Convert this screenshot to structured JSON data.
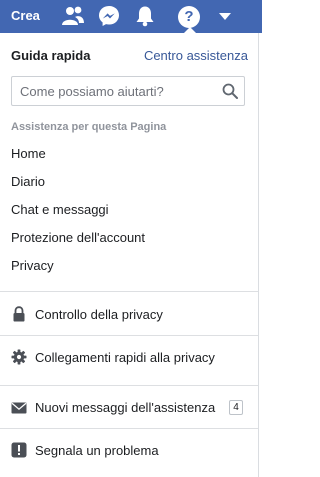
{
  "topbar": {
    "create_label": "Crea",
    "icons": [
      "friends-icon",
      "messenger-icon",
      "notifications-icon",
      "help-icon",
      "menu-caret-icon"
    ],
    "help_glyph": "?",
    "color": "#4267b2"
  },
  "help_panel": {
    "title": "Guida rapida",
    "help_center_link": "Centro assistenza",
    "search": {
      "placeholder": "Come possiamo aiutarti?",
      "value": ""
    },
    "section_label": "Assistenza per questa Pagina",
    "topics": [
      "Home",
      "Diario",
      "Chat e messaggi",
      "Protezione dell'account",
      "Privacy"
    ],
    "privacy_checkup": "Controllo della privacy",
    "privacy_shortcuts": "Collegamenti rapidi alla privacy",
    "support_inbox": {
      "label": "Nuovi messaggi dell'assistenza",
      "count": "4"
    },
    "report_problem": "Segnala un problema",
    "link_color": "#385898"
  }
}
